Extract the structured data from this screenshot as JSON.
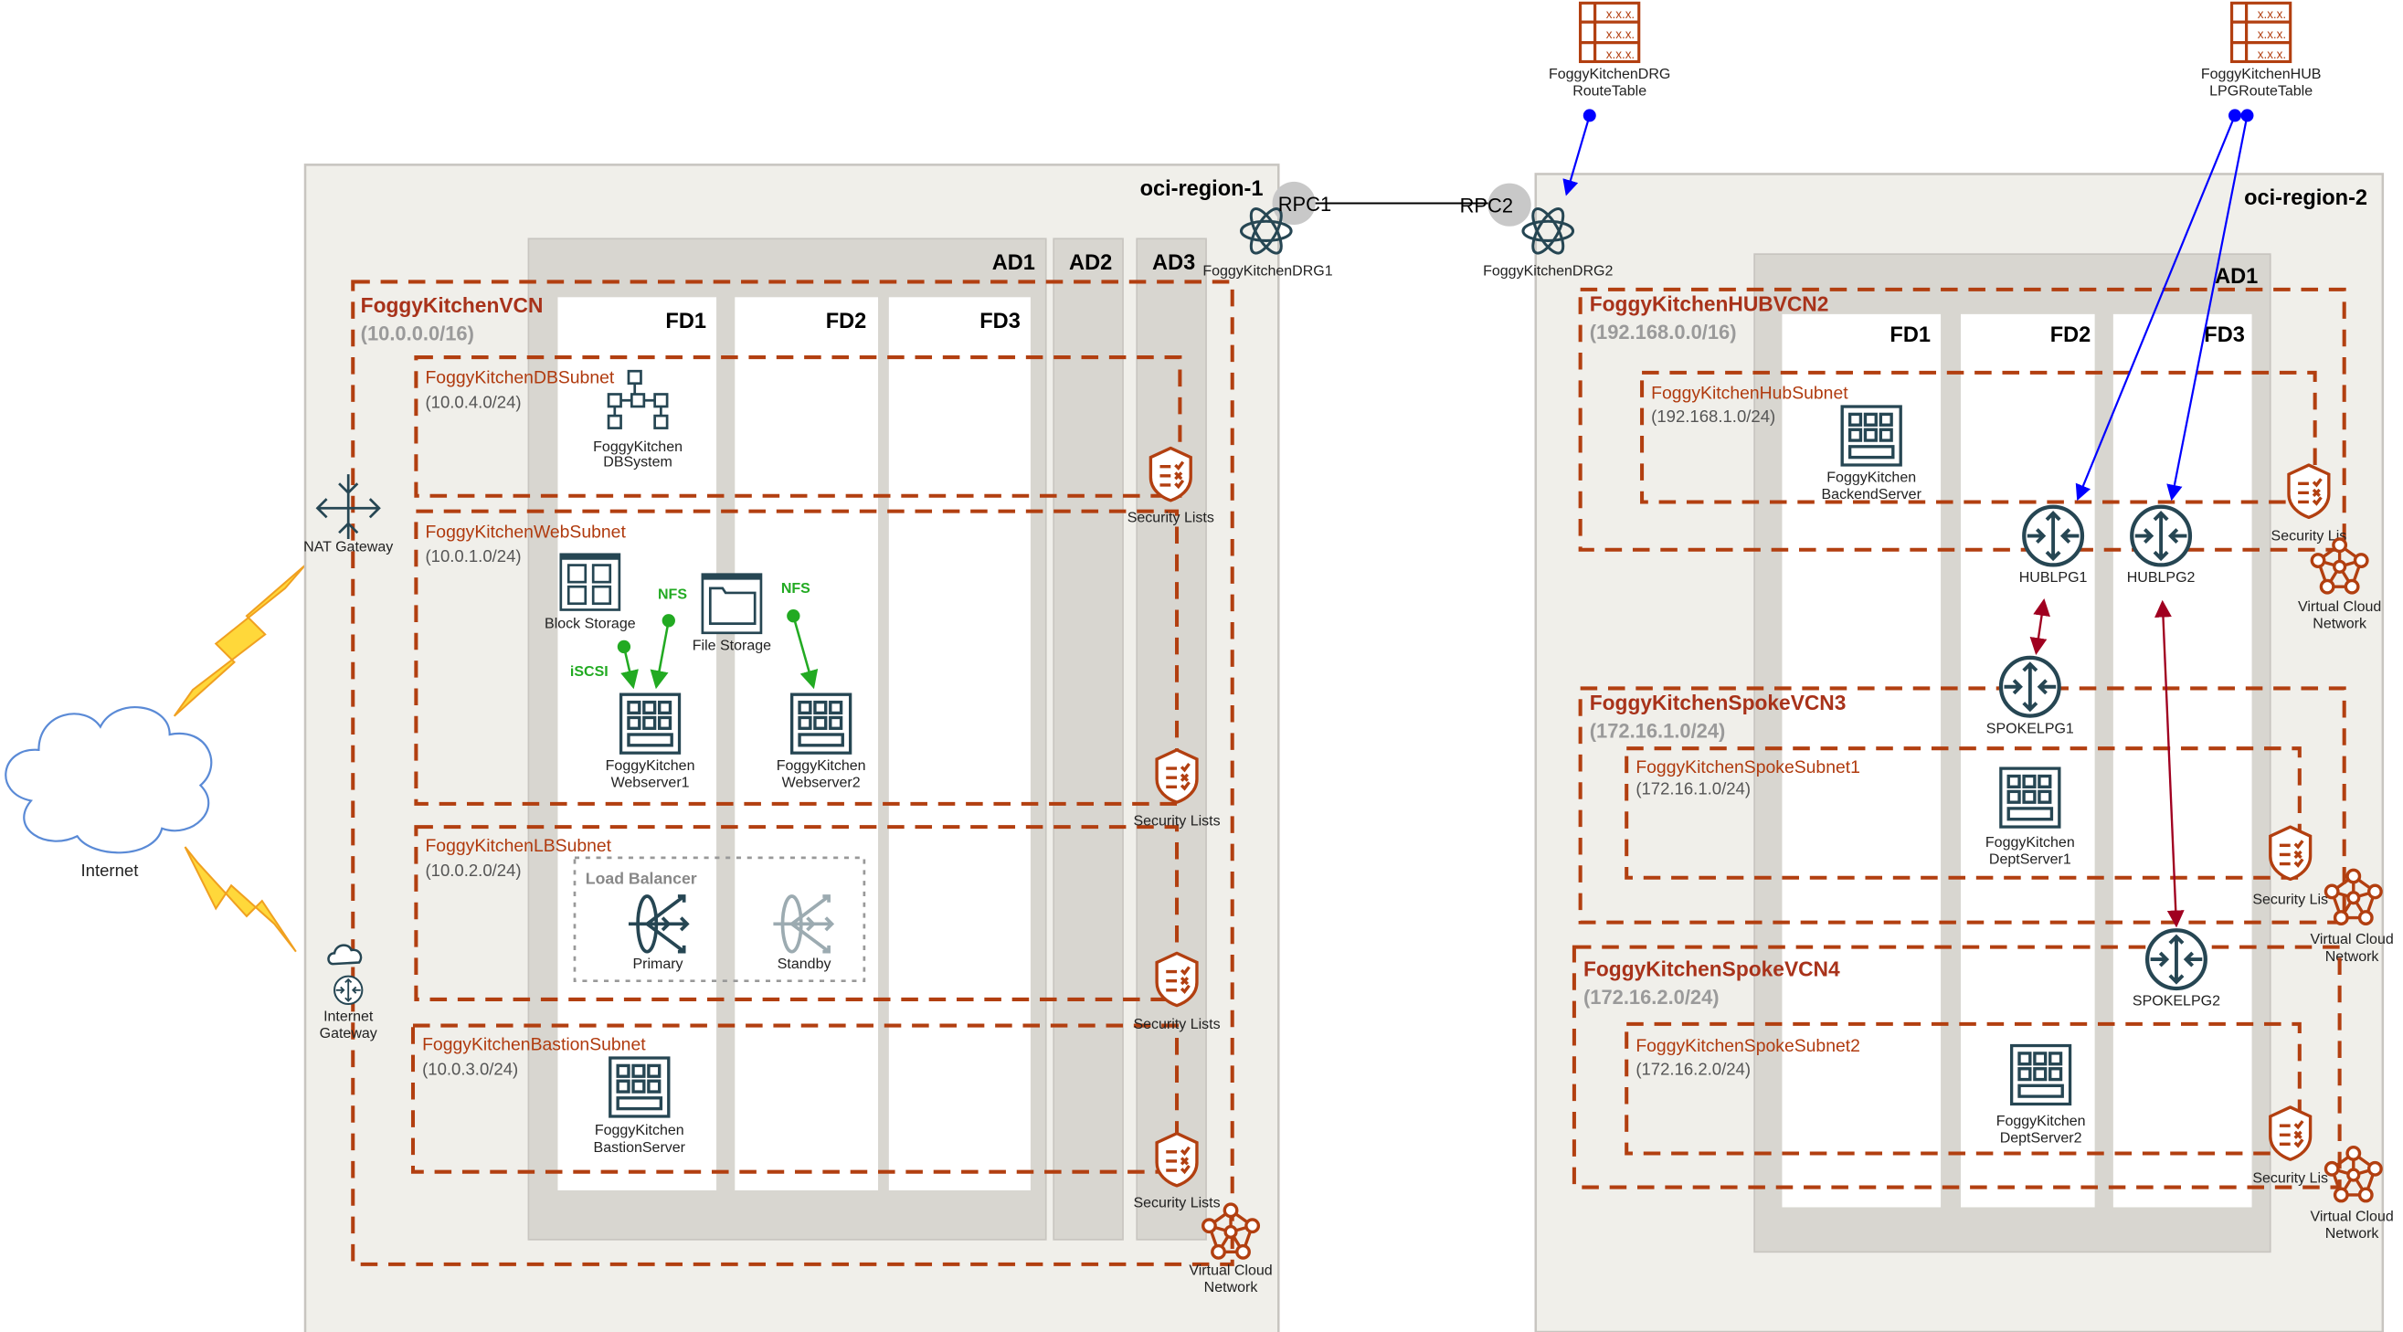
{
  "colors": {
    "vcn_border": "#b23f10",
    "vcn_label": "#a8321a",
    "icon": "#264653",
    "route_arrow": "#0000ff",
    "lpg_link": "#a00020",
    "storage_link": "#22aa22"
  },
  "internet": {
    "label": "Internet"
  },
  "region1": {
    "title": "oci-region-1",
    "ads": [
      "AD1",
      "AD2",
      "AD3"
    ],
    "fds": [
      "FD1",
      "FD2",
      "FD3"
    ],
    "vcn": {
      "name": "FoggyKitchenVCN",
      "cidr": "(10.0.0.0/16)"
    },
    "nat_gateway": "NAT Gateway",
    "internet_gateway": [
      "Internet",
      "Gateway"
    ],
    "subnets": [
      {
        "name": "FoggyKitchenDBSubnet",
        "cidr": "(10.0.4.0/24)"
      },
      {
        "name": "FoggyKitchenWebSubnet",
        "cidr": "(10.0.1.0/24)"
      },
      {
        "name": "FoggyKitchenLBSubnet",
        "cidr": "(10.0.2.0/24)"
      },
      {
        "name": "FoggyKitchenBastionSubnet",
        "cidr": "(10.0.3.0/24)"
      }
    ],
    "db_system": [
      "FoggyKitchen",
      "DBSystem"
    ],
    "block_storage": "Block Storage",
    "file_storage": "File Storage",
    "nfs": "NFS",
    "iscsi": "iSCSI",
    "webserver1": [
      "FoggyKitchen",
      "Webserver1"
    ],
    "webserver2": [
      "FoggyKitchen",
      "Webserver2"
    ],
    "load_balancer": {
      "title": "Load Balancer",
      "primary": "Primary",
      "standby": "Standby"
    },
    "bastion": [
      "FoggyKitchen",
      "BastionServer"
    ],
    "security_lists": "Security Lists",
    "vcn_icon": [
      "Virtual Cloud",
      "Network"
    ],
    "drg": "FoggyKitchenDRG1",
    "rpc": "RPC1"
  },
  "region2": {
    "title": "oci-region-2",
    "ads": [
      "AD1"
    ],
    "fds": [
      "FD1",
      "FD2",
      "FD3"
    ],
    "drg": "FoggyKitchenDRG2",
    "rpc": "RPC2",
    "hub_vcn": {
      "name": "FoggyKitchenHUBVCN2",
      "cidr": "(192.168.0.0/16)",
      "subnet": "FoggyKitchenHubSubnet",
      "subnet_cidr": "(192.168.1.0/24)",
      "server": [
        "FoggyKitchen",
        "BackendServer"
      ],
      "lpg1": "HUBLPG1",
      "lpg2": "HUBLPG2"
    },
    "spoke3": {
      "name": "FoggyKitchenSpokeVCN3",
      "cidr": "(172.16.1.0/24)",
      "subnet": "FoggyKitchenSpokeSubnet1",
      "subnet_cidr": "(172.16.1.0/24)",
      "server": [
        "FoggyKitchen",
        "DeptServer1"
      ],
      "lpg": "SPOKELPG1"
    },
    "spoke4": {
      "name": "FoggyKitchenSpokeVCN4",
      "cidr": "(172.16.2.0/24)",
      "subnet": "FoggyKitchenSpokeSubnet2",
      "subnet_cidr": "(172.16.2.0/24)",
      "server": [
        "FoggyKitchen",
        "DeptServer2"
      ],
      "lpg": "SPOKELPG2"
    },
    "security_lists_truncated": "Security Lis",
    "vcn_icon": [
      "Virtual Cloud",
      "Network"
    ]
  },
  "route_tables": {
    "cell_text": "x.x.x.",
    "drg": [
      "FoggyKitchenDRG",
      "RouteTable"
    ],
    "hub": [
      "FoggyKitchenHUB",
      "LPGRouteTable"
    ]
  }
}
